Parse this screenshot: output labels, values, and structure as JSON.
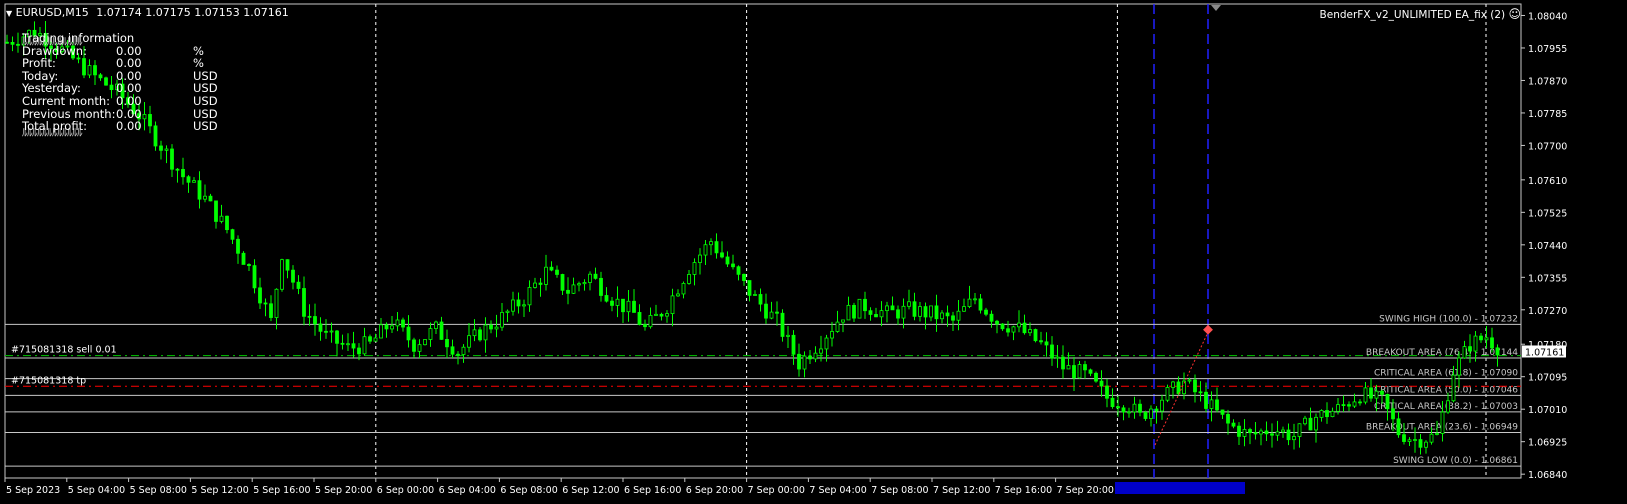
{
  "header": {
    "symbol": "EURUSD,M15",
    "ohlc": "1.07174 1.07175 1.07153 1.07161",
    "ea_name": "BenderFX_v2_UNLIMITED EA_fix (2)"
  },
  "colors": {
    "background": "#000000",
    "candle": "#00ff00",
    "grid": "#ffffff",
    "level_line": "#c8c8c8",
    "order_line": "#00c800",
    "tp_line": "#ff0000",
    "period_line": "#2020ff",
    "price_tag_bg": "#ffffff"
  },
  "info_panel": {
    "title": "Trading information",
    "garble": "ﾙﾙﾙﾙﾙﾙﾙﾙﾙﾙﾙﾙ",
    "rows": [
      {
        "label": "Drawdown:",
        "value": "0.00",
        "unit": "%"
      },
      {
        "label": "Profit:",
        "value": "0.00",
        "unit": "%"
      },
      {
        "label": "Today:",
        "value": "0.00",
        "unit": "USD"
      },
      {
        "label": "Yesterday:",
        "value": "0.00",
        "unit": "USD"
      },
      {
        "label": "Current month:",
        "value": "0.00",
        "unit": "USD"
      },
      {
        "label": "Previous month:",
        "value": "0.00",
        "unit": "USD"
      },
      {
        "label": "Total profit:",
        "value": "0.00",
        "unit": "USD"
      }
    ]
  },
  "orders": {
    "sell_label": "#715081318 sell 0.01",
    "tp_label": "#715081318 tp",
    "sell_price": 1.0715,
    "tp_price": 1.0707
  },
  "current_price": {
    "value": 1.07161,
    "label": "1.07161"
  },
  "chart_data": {
    "type": "candlestick",
    "symbol": "EURUSD",
    "timeframe": "M15",
    "ylim": [
      1.0683,
      1.0807
    ],
    "y_ticks": [
      "1.08040",
      "1.07955",
      "1.07870",
      "1.07785",
      "1.07700",
      "1.07610",
      "1.07525",
      "1.07440",
      "1.07355",
      "1.07270",
      "1.07180",
      "1.07095",
      "1.07010",
      "1.06925",
      "1.06840"
    ],
    "x_ticks": [
      "5 Sep 2023",
      "5 Sep 04:00",
      "5 Sep 08:00",
      "5 Sep 12:00",
      "5 Sep 16:00",
      "5 Sep 20:00",
      "6 Sep 00:00",
      "6 Sep 04:00",
      "6 Sep 08:00",
      "6 Sep 12:00",
      "6 Sep 16:00",
      "6 Sep 20:00",
      "7 Sep 00:00",
      "7 Sep 04:00",
      "7 Sep 08:00",
      "7 Sep 12:00",
      "7 Sep 16:00",
      "7 Sep 20:00"
    ],
    "day_separators": [
      "6 Sep 00:00",
      "7 Sep 00:00",
      "8 Sep 00:00"
    ],
    "levels": [
      {
        "name": "SWING HIGH (100.0)",
        "label": "SWING HIGH (100.0) - 1.07232",
        "value": 1.07232
      },
      {
        "name": "BREAKOUT AREA (76.4)",
        "label": "BREAKOUT AREA (76.4) - 1.07144",
        "value": 1.07144
      },
      {
        "name": "CRITICAL AREA (61.8)",
        "label": "CRITICAL AREA (61.8) - 1.07090",
        "value": 1.0709
      },
      {
        "name": "CRITICAL AREA (50.0)",
        "label": "CRITICAL AREA (50.0) - 1.07046",
        "value": 1.07046
      },
      {
        "name": "CRITICAL AREA (38.2)",
        "label": "CRITICAL AREA (38.2) - 1.07003",
        "value": 1.07003
      },
      {
        "name": "BREAKOUT AREA (23.6)",
        "label": "BREAKOUT AREA (23.6) - 1.06949",
        "value": 1.06949
      },
      {
        "name": "SWING LOW (0.0)",
        "label": "SWING LOW (0.0) - 1.06861",
        "value": 1.06861
      }
    ],
    "path_points": [
      [
        0,
        1.0797
      ],
      [
        5,
        1.08
      ],
      [
        10,
        1.0795
      ],
      [
        16,
        1.0788
      ],
      [
        20,
        1.0784
      ],
      [
        24,
        1.0778
      ],
      [
        28,
        1.077
      ],
      [
        32,
        1.0762
      ],
      [
        36,
        1.0756
      ],
      [
        40,
        1.0748
      ],
      [
        44,
        1.0738
      ],
      [
        48,
        1.0724
      ],
      [
        50,
        1.0742
      ],
      [
        54,
        1.0727
      ],
      [
        58,
        1.072
      ],
      [
        62,
        1.0717
      ],
      [
        66,
        1.0718
      ],
      [
        70,
        1.0724
      ],
      [
        74,
        1.0718
      ],
      [
        78,
        1.0722
      ],
      [
        82,
        1.0716
      ],
      [
        86,
        1.0721
      ],
      [
        90,
        1.0725
      ],
      [
        94,
        1.073
      ],
      [
        98,
        1.0737
      ],
      [
        102,
        1.0732
      ],
      [
        106,
        1.0736
      ],
      [
        110,
        1.073
      ],
      [
        114,
        1.0726
      ],
      [
        116,
        1.0722
      ],
      [
        120,
        1.0728
      ],
      [
        124,
        1.0738
      ],
      [
        128,
        1.0745
      ],
      [
        132,
        1.0737
      ],
      [
        136,
        1.073
      ],
      [
        140,
        1.0724
      ],
      [
        144,
        1.0713
      ],
      [
        148,
        1.0719
      ],
      [
        152,
        1.0726
      ],
      [
        156,
        1.0728
      ],
      [
        160,
        1.0726
      ],
      [
        164,
        1.0727
      ],
      [
        168,
        1.0726
      ],
      [
        172,
        1.0724
      ],
      [
        176,
        1.073
      ],
      [
        180,
        1.0724
      ],
      [
        184,
        1.0722
      ],
      [
        188,
        1.0718
      ],
      [
        192,
        1.0712
      ],
      [
        196,
        1.071
      ],
      [
        200,
        1.0704
      ],
      [
        204,
        1.0702
      ],
      [
        206,
        1.0699
      ],
      [
        210,
        1.0704
      ],
      [
        214,
        1.0708
      ],
      [
        218,
        1.0703
      ],
      [
        222,
        1.0697
      ],
      [
        226,
        1.0694
      ],
      [
        230,
        1.0696
      ],
      [
        234,
        1.0694
      ],
      [
        238,
        1.0699
      ],
      [
        242,
        1.0701
      ],
      [
        246,
        1.0705
      ],
      [
        250,
        1.0703
      ],
      [
        253,
        1.0695
      ],
      [
        256,
        1.0693
      ],
      [
        260,
        1.0694
      ],
      [
        263,
        1.0711
      ],
      [
        266,
        1.0718
      ],
      [
        269,
        1.072
      ],
      [
        272,
        1.0716
      ]
    ]
  }
}
